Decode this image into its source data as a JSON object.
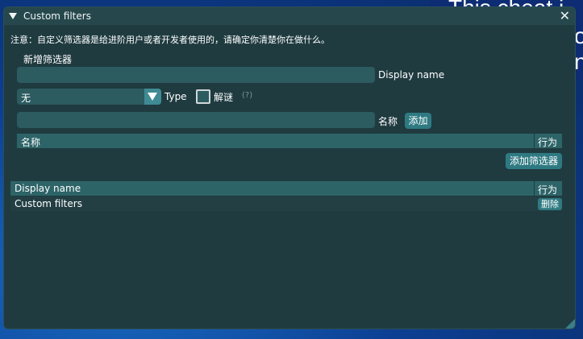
{
  "background": {
    "line1": "This cheat i",
    "line2": "o",
    "line3": "n"
  },
  "window": {
    "title": "Custom filters",
    "notice": "注意：自定义筛选器是给进阶用户或者开发者使用的，请确定你清楚你在做什么。",
    "add_filter_section": "新增筛选器",
    "display_name_label": "Display name",
    "display_name_value": "",
    "type_select_value": "无",
    "type_label": "Type",
    "puzzle_checkbox_label": "解谜",
    "puzzle_checkbox_checked": false,
    "help_marker": "(?)",
    "name_label": "名称",
    "name_value": "",
    "add_button": "添加",
    "names_table": {
      "columns": [
        "名称",
        "行为"
      ],
      "rows": []
    },
    "add_filter_button": "添加筛选器",
    "filters_table": {
      "columns": [
        "Display name",
        "行为"
      ],
      "rows": [
        {
          "name": "Custom filters",
          "action": "删除"
        }
      ]
    }
  }
}
